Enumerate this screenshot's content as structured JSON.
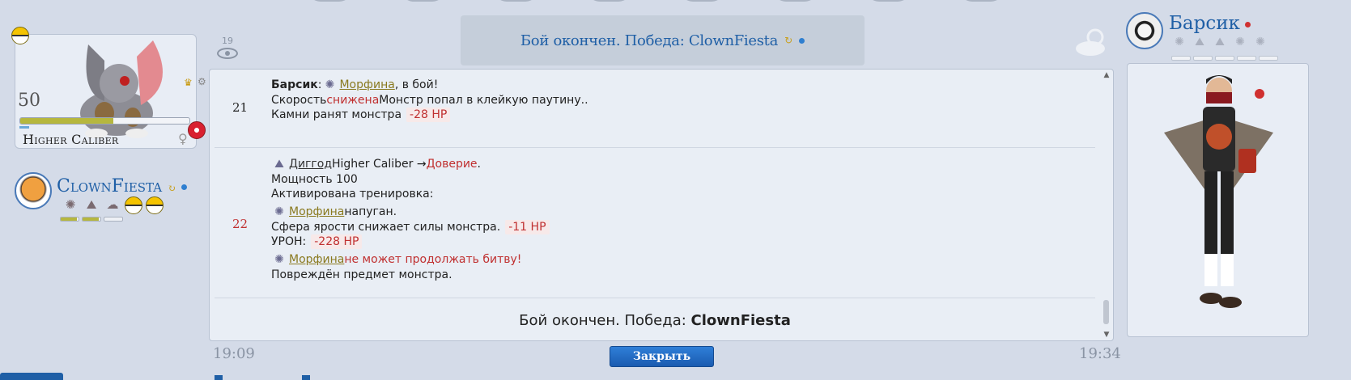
{
  "monster": {
    "level": "50",
    "name": "Higher Caliber",
    "hp_fraction": 0.55,
    "gender_symbol": "♀"
  },
  "opponent": {
    "name": "ClownFiesta",
    "refresh_symbol": "↻",
    "team_bars": [
      0.9,
      0.9,
      0.0
    ]
  },
  "turn_counter": "19",
  "status_banner": {
    "text": "Бой окончен. Победа: ClownFiesta",
    "refresh_symbol": "↻"
  },
  "log": {
    "turns": [
      {
        "number": "21",
        "number_color": "#8a94a4",
        "line1_user": "Барсик",
        "line1_colon": ": ",
        "line1_mon": " Морфина",
        "line1_tail": ", в бой!",
        "line2_a": "Скорость ",
        "line2_red": "снижена",
        "line2_b": " Монстр попал в клейкую паутину..",
        "line3_text": "Камни ранят монстра",
        "line3_dmg": "-28 HP"
      },
      {
        "number": "22",
        "number_color": "#c03030",
        "line1_mon": " Диггод",
        "line1_text": " Higher Caliber → ",
        "line1_red": "Доверие",
        "line1_tail": ".",
        "line2": "Мощность 100",
        "line3": "Активирована тренировка:",
        "line4_mon": " Морфина",
        "line4_tail": " напуган.",
        "line5_text": "Сфера ярости снижает силы монстра.",
        "line5_dmg": "-11 HP",
        "line6_text": "УРОН:",
        "line6_dmg": "-228 HP",
        "line7_mon": " Морфина",
        "line7_red": " не может продолжать битву!",
        "line8": "Повреждён предмет монстра."
      }
    ],
    "final_prefix": "Бой окончен. Победа: ",
    "final_winner": "ClownFiesta"
  },
  "footer": {
    "time_start": "19:09",
    "time_end": "19:34",
    "close_label": "Закрыть"
  },
  "player": {
    "name": "Барсик"
  },
  "colors": {
    "accent": "#1f5fa6",
    "damage": "#c03030",
    "hp": "#b6b73e",
    "background": "#d4dbe8"
  },
  "icons": {
    "weather": "cloud-sun-icon",
    "eye": "eye-icon",
    "close": "close-button",
    "crown": "crown-icon"
  }
}
